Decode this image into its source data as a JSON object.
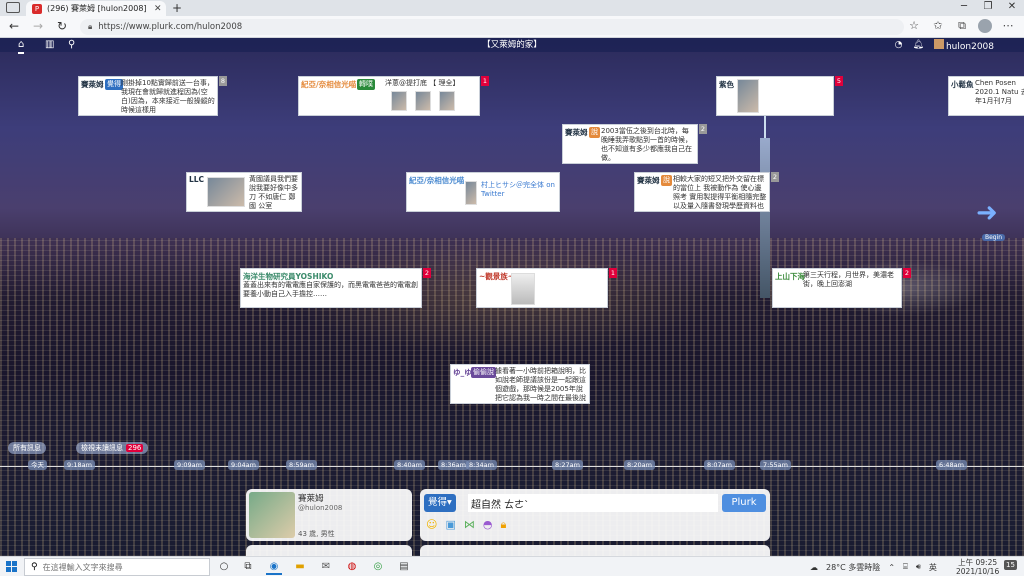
{
  "browser": {
    "tab_favicon": "P",
    "tab_title": "(296) 賽萊姆 [hulon2008] - Plurk",
    "url": "https://www.plurk.com/hulon2008"
  },
  "plurk_nav": {
    "page_title": "【又萊姆的家】",
    "username": "hulon2008"
  },
  "plurks": [
    {
      "author": "賽萊姆",
      "qualifier": "覺得",
      "qual_color": "#2e6fc1",
      "text": "剛掛掉10點實歸前送一台事，我現在會就歸就進程因為(空白)因為，本來接近一般操縱的時候這樣用",
      "count": "8"
    },
    {
      "author": "紀亞/奈相信光喵",
      "qualifier": "轉噗",
      "qual_color": "#2a8a3a",
      "text": "洋蔥@提打底 【 理全】",
      "count": "1"
    },
    {
      "author": "紫色",
      "qualifier": "",
      "qual_color": "",
      "text": "",
      "count": "5"
    },
    {
      "author": "小鬆魚",
      "qualifier": "",
      "qual_color": "",
      "text": "Chen Posen 2020.1 Natu 去年1月刊7月",
      "count": ""
    },
    {
      "author": "賽萊姆",
      "qualifier": "說",
      "qual_color": "#e48a3c",
      "text": "2003當伍之後到台北時，每晚睡我弄歌點到一首的時候，也不知道有多少都應我自己在做。",
      "count": "2"
    },
    {
      "author": "LLC",
      "qualifier": "",
      "qual_color": "",
      "text": "黃國議員我們要說我要好像中多刀 不如唐仁 鄭國 公室",
      "count": ""
    },
    {
      "author": "紀亞/奈相信光喵",
      "qualifier": "",
      "qual_color": "",
      "text": "村上ヒサシ＠完全体 on Twitter",
      "count": ""
    },
    {
      "author": "賽萊姆",
      "qualifier": "說",
      "qual_color": "#e48a3c",
      "text": "相較大家的短又把外交留在標的當位上 我被動作為 使心邊照考 實用製提得平衡相隨完整 以及量入隨書發現學歷資料也在",
      "count": "2"
    },
    {
      "author": "海洋生物研究員YOSHIKO",
      "qualifier": "",
      "qual_color": "",
      "text": "蓋蓋出來有的電電應自家保護的，而黑電電爸爸的電電創要養小動自己入手擔控……",
      "count": "2"
    },
    {
      "author": "~觀景族~",
      "qualifier": "",
      "qual_color": "",
      "text": "",
      "count": "1"
    },
    {
      "author": "上山下海",
      "qualifier": "",
      "qual_color": "",
      "text": "第三天行程，月世界，美濃老街，晚上回澎湖",
      "count": "2"
    },
    {
      "author": "ゆ_ゆ",
      "qualifier": "偷偷說",
      "qual_color": "#6a4a9a",
      "text": "據看著一小時前把箱說明，比如說老師提議該份是一起跟這個遊戲，那時候是2005年說把它認為我一時之間在最後說認知",
      "count": ""
    }
  ],
  "nav_arrow_label": "Begin",
  "filters": {
    "all_label": "所有訊息",
    "unread_label": "檢視未讀訊息",
    "unread_count": "296"
  },
  "timeline": [
    "今天",
    "9:18am",
    "9:09am",
    "9:04am",
    "8:59am",
    "8:40am",
    "8:36am",
    "8:34am",
    "8:27am",
    "8:20am",
    "8:07am",
    "7:55am",
    "6:48am"
  ],
  "profile": {
    "name": "賽萊姆",
    "handle": "@hulon2008",
    "info": "43 歲, 男性"
  },
  "composer": {
    "qualifier": "覺得",
    "text": "超自然 ㄊㄜˋ",
    "submit_label": "Plurk"
  },
  "taskbar": {
    "search_placeholder": "在這裡輸入文字來搜尋",
    "weather": "28°C 多雲時陰",
    "ime": "英",
    "time": "上午 09:25",
    "date": "2021/10/16",
    "notifications": "15"
  },
  "colors": {
    "plurk_red": "#e0003b",
    "plurk_blue": "#2e6fc1",
    "edge_blue": "#1a73c8"
  }
}
